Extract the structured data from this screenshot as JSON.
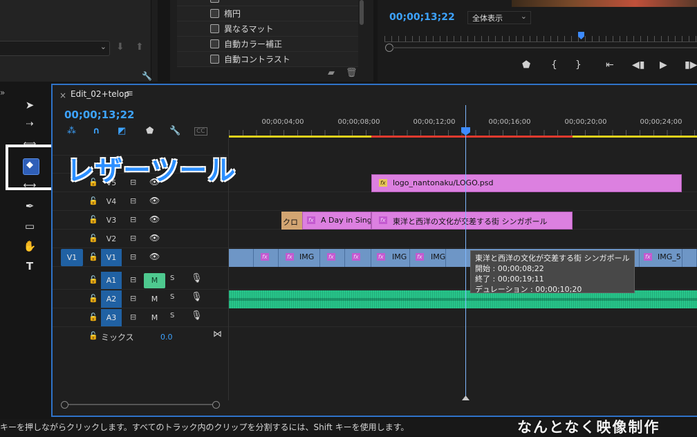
{
  "effects_list": {
    "items": [
      "楕円",
      "異なるマット",
      "自動カラー補正",
      "自動コントラスト"
    ]
  },
  "monitor": {
    "timecode": "00;00;13;22",
    "zoom_option": "全体表示"
  },
  "timeline": {
    "close": "×",
    "title": "Edit_02+telop",
    "menu": "≡",
    "timecode": "00;00;13;22",
    "ruler_labels": [
      "00;00;04;00",
      "00;00;08;00",
      "00;00;12;00",
      "00;00;16;00",
      "00;00;20;00",
      "00;00;24;00"
    ]
  },
  "tracks": {
    "v5": "V5",
    "v4": "V4",
    "v3": "V3",
    "v2": "V2",
    "v1_source": "V1",
    "v1": "V1",
    "a1": "A1",
    "a2": "A2",
    "a3": "A3",
    "mute": "M",
    "solo": "S",
    "mix_label": "ミックス",
    "mix_value": "0.0"
  },
  "clips": {
    "logo": "logo_nantonaku/LOGO.psd",
    "kuro": "クロ",
    "day_in_singa": "A Day in Singa",
    "title_v3": "東洋と西洋の文化が交差する街 シンガポール",
    "img": "IMG",
    "img5": "IMG_5",
    "fx": "fx"
  },
  "tooltip": {
    "line1": "東洋と西洋の文化が交差する街 シンガポール",
    "line2": "開始 : 00;00;08;22",
    "line3": "終了 : 00;00;19;11",
    "line4": "デュレーション : 00;00;10;20"
  },
  "annotation": {
    "razor_tool_label": "レザーツール"
  },
  "status_bar": {
    "text": "キーを押しながらクリックします。すべてのトラック内のクリップを分割するには、Shift キーを使用します。"
  },
  "watermark": {
    "text": "なんとなく映像制作"
  },
  "colors": {
    "accent": "#3da3ff",
    "selection": "#2f73c9",
    "title_clip": "#dc80e0",
    "video_clip": "#6e96c6",
    "audio_clip": "#27c58a",
    "mute_on": "#4ec98f",
    "workarea_red": "#e53a2e",
    "workarea_yellow": "#e0d21c"
  }
}
